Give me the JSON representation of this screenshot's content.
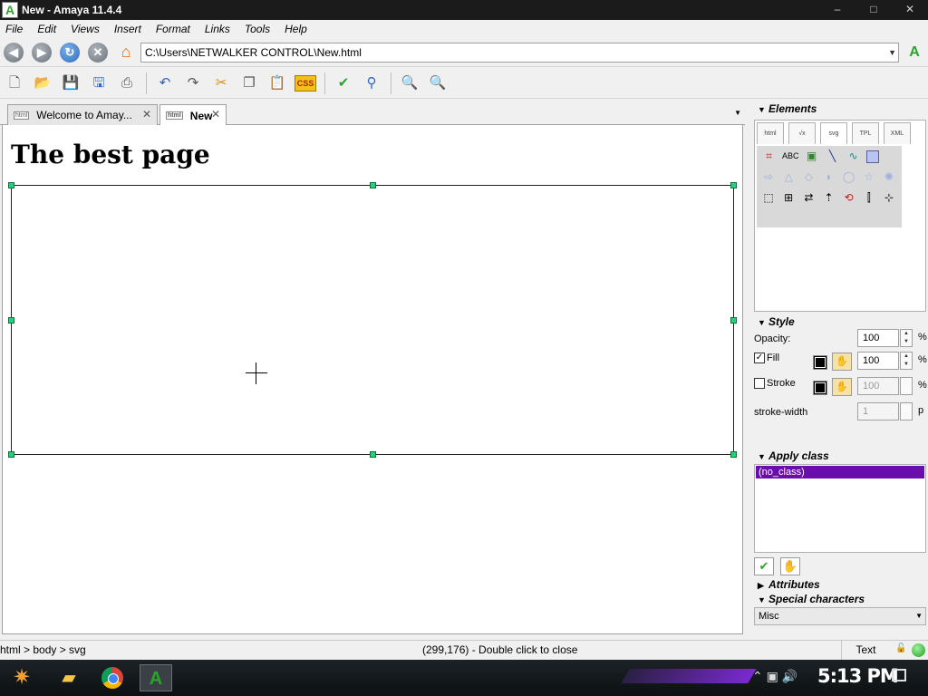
{
  "window": {
    "title": "New - Amaya 11.4.4",
    "minimize": "–",
    "maximize": "□",
    "close": "✕"
  },
  "menu": [
    "File",
    "Edit",
    "Views",
    "Insert",
    "Format",
    "Links",
    "Tools",
    "Help"
  ],
  "address": {
    "url": "C:\\Users\\NETWALKER CONTROL\\New.html"
  },
  "tabs": [
    {
      "label": "Welcome to Amay...",
      "icon": "html-file-icon"
    },
    {
      "label": "New",
      "icon": "html-file-icon",
      "active": true
    }
  ],
  "document": {
    "heading": "The best page"
  },
  "panel": {
    "elements_title": "Elements",
    "element_tabs": [
      "html",
      "√x",
      "svg",
      "TPL",
      "XML"
    ],
    "palette_text_label": "ABC",
    "style_title": "Style",
    "opacity_label": "Opacity:",
    "opacity_value": "100",
    "fill_label": "Fill",
    "fill_value": "100",
    "stroke_label": "Stroke",
    "stroke_value": "100",
    "stroke_width_label": "stroke-width",
    "stroke_width_value": "1",
    "percent_sign": "%",
    "px_unit": "p",
    "apply_class_title": "Apply class",
    "class_selected": "(no_class)",
    "attributes_title": "Attributes",
    "special_chars_title": "Special characters",
    "special_chars_select": "Misc"
  },
  "status": {
    "path": "html > body > svg",
    "message": "(299,176) - Double click to close",
    "mode": "Text"
  },
  "taskbar": {
    "clock": "5:13 PM"
  },
  "colors": {
    "selection_handle": "#1fd47a",
    "class_highlight": "#6a0dad",
    "amaya_green": "#2aa52a"
  }
}
